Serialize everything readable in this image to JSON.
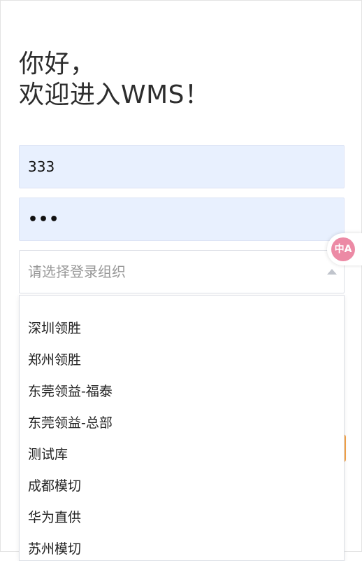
{
  "greeting": {
    "line1": "你好，",
    "line2": "欢迎进入WMS！"
  },
  "login": {
    "username_value": "333",
    "password_mask": "•••",
    "org_placeholder": "请选择登录组织"
  },
  "org_dropdown": {
    "options": [
      "深圳领胜",
      "郑州领胜",
      "东莞领益-福泰",
      "东莞领益-总部",
      "测试库",
      "成都模切",
      "华为直供",
      "苏州模切"
    ]
  },
  "translate_fab": {
    "icon": "translate-icon",
    "glyph": "中A"
  },
  "colors": {
    "autofill_bg": "#e8f0fe",
    "border": "#dcdfe6",
    "fab_pink": "#ec8aa5",
    "accent_orange": "#f5a347"
  }
}
